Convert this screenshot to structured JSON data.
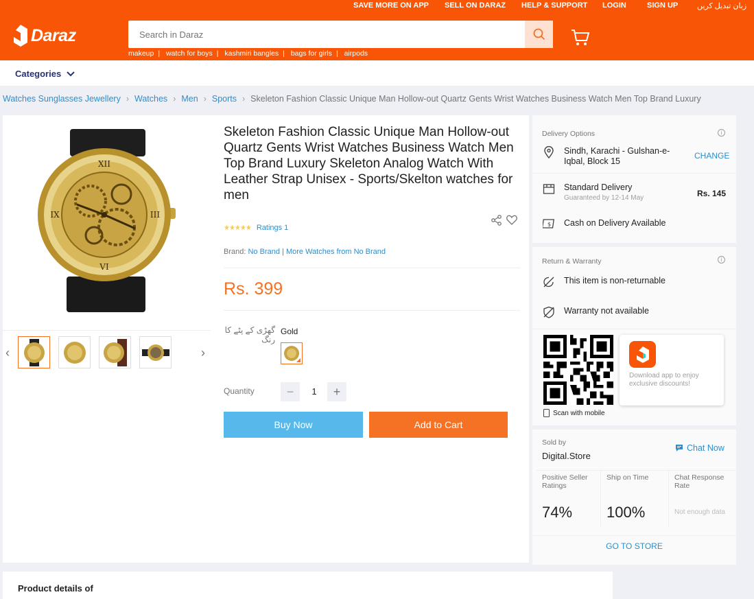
{
  "topbar": {
    "links": [
      "SAVE MORE ON APP",
      "SELL ON DARAZ",
      "HELP & SUPPORT",
      "LOGIN",
      "SIGN UP",
      "زبان تبدیل کریں"
    ],
    "logo_text": "Daraz",
    "search_placeholder": "Search in Daraz",
    "suggestions": [
      "makeup",
      "watch for boys",
      "kashmiri bangles",
      "bags for girls",
      "airpods"
    ],
    "brand_color": "#f85606"
  },
  "categories_label": "Categories",
  "breadcrumb": [
    "Watches Sunglasses Jewellery",
    "Watches",
    "Men",
    "Sports",
    "Skeleton Fashion Classic Unique Man Hollow-out Quartz Gents Wrist Watches Business Watch Men Top Brand Luxury"
  ],
  "product": {
    "title": "Skeleton Fashion Classic Unique Man Hollow-out Quartz Gents Wrist Watches Business Watch Men Top Brand Luxury Skeleton Analog Watch With Leather Strap Unisex - Sports/Skelton watches for men",
    "stars": "★★★★★",
    "ratings": "Ratings 1",
    "brand_label": "Brand:",
    "brand": "No Brand",
    "more_from": "More Watches from No Brand",
    "price": "Rs. 399",
    "color_label": "گھڑی کے پٹے کا رنگ",
    "color_value": "Gold",
    "quantity_label": "Quantity",
    "quantity": "1",
    "buy_now": "Buy Now",
    "add_to_cart": "Add to Cart",
    "thumbnail_count": 4,
    "accent_color": "#f57224"
  },
  "delivery": {
    "header": "Delivery Options",
    "location": "Sindh, Karachi - Gulshan-e-Iqbal, Block 15",
    "change": "CHANGE",
    "standard": "Standard Delivery",
    "guaranteed": "Guaranteed by 12-14 May",
    "fee": "Rs. 145",
    "cod": "Cash on Delivery Available"
  },
  "warranty": {
    "header": "Return & Warranty",
    "returnable": "This item is non-returnable",
    "warranty": "Warranty not available"
  },
  "app": {
    "scan": "Scan with mobile",
    "download": "Download app to enjoy exclusive discounts!"
  },
  "seller": {
    "sold_by": "Sold by",
    "name": "Digital.Store",
    "chat": "Chat Now",
    "stats": [
      {
        "label": "Positive Seller Ratings",
        "value": "74%"
      },
      {
        "label": "Ship on Time",
        "value": "100%"
      },
      {
        "label": "Chat Response Rate",
        "value": "Not enough data"
      }
    ],
    "go_to_store": "GO TO STORE"
  },
  "details_heading": "Product details of"
}
